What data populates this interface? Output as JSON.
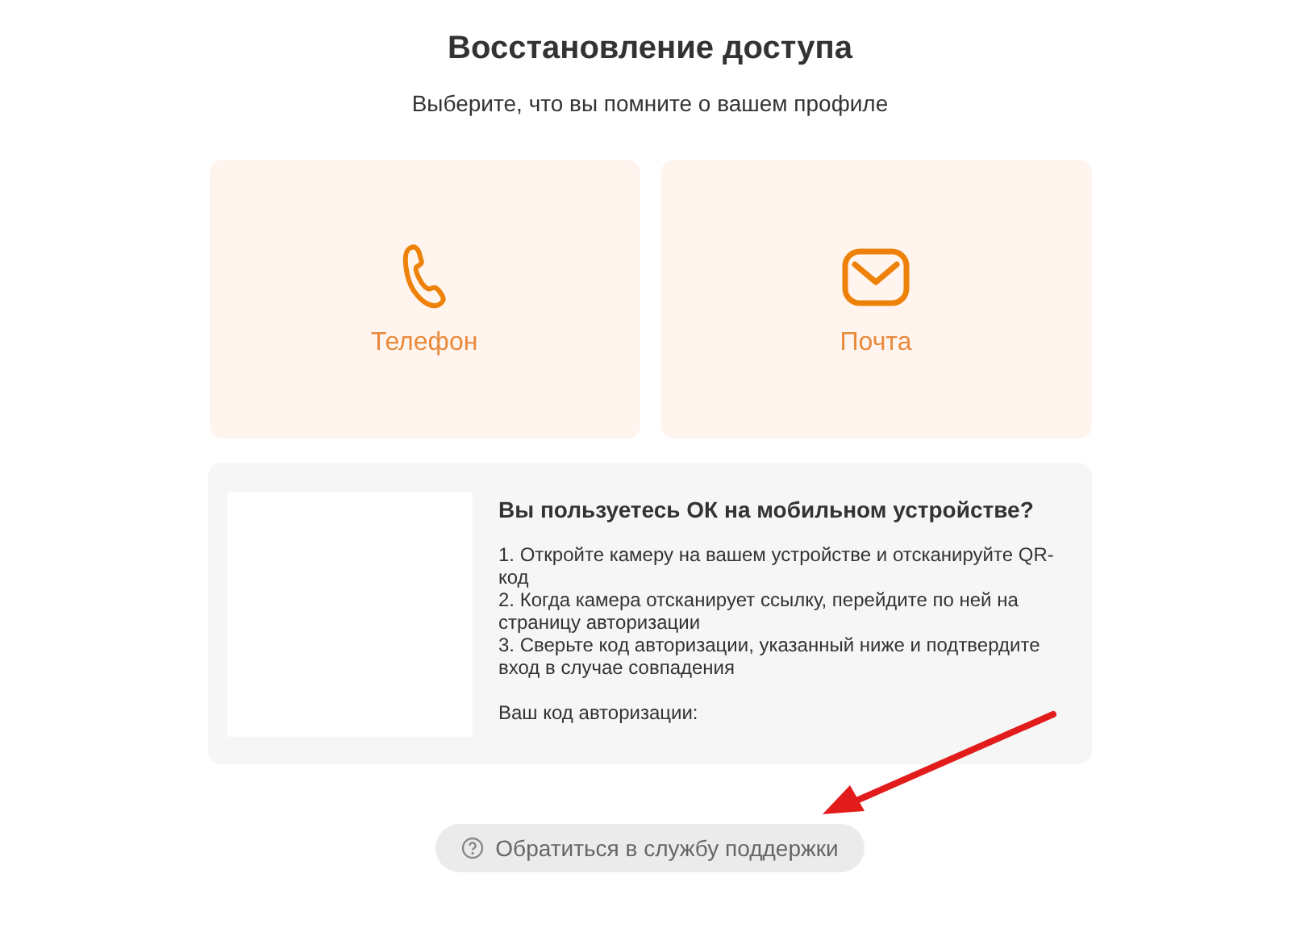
{
  "title": "Восстановление доступа",
  "subtitle": "Выберите, что вы помните о вашем профиле",
  "options": [
    {
      "kind": "phone",
      "label": "Телефон"
    },
    {
      "kind": "mail",
      "label": "Почта"
    }
  ],
  "mobile": {
    "heading": "Вы пользуетесь ОК на мобильном устройстве?",
    "steps": [
      "1. Откройте камеру на вашем устройстве и отсканируйте QR-код",
      "2. Когда камера отсканирует ссылку, перейдите по ней на страницу авторизации",
      "3. Сверьте код авторизации, указанный ниже и подтвердите вход в случае совпадения"
    ],
    "code_label": "Ваш код авторизации:"
  },
  "support_button": "Обратиться в службу поддержки"
}
